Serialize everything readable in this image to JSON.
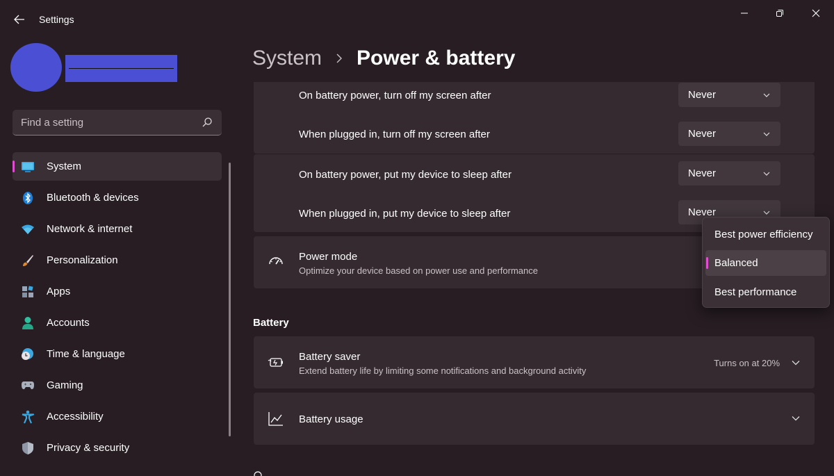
{
  "window": {
    "title": "Settings"
  },
  "search": {
    "placeholder": "Find a setting"
  },
  "nav": {
    "items": [
      {
        "label": "System",
        "icon": "monitor-icon",
        "selected": true
      },
      {
        "label": "Bluetooth & devices",
        "icon": "bluetooth-icon"
      },
      {
        "label": "Network & internet",
        "icon": "wifi-icon"
      },
      {
        "label": "Personalization",
        "icon": "brush-icon"
      },
      {
        "label": "Apps",
        "icon": "apps-icon"
      },
      {
        "label": "Accounts",
        "icon": "person-icon"
      },
      {
        "label": "Time & language",
        "icon": "globe-clock-icon"
      },
      {
        "label": "Gaming",
        "icon": "gamepad-icon"
      },
      {
        "label": "Accessibility",
        "icon": "accessibility-icon"
      },
      {
        "label": "Privacy & security",
        "icon": "shield-icon"
      }
    ]
  },
  "header": {
    "parent": "System",
    "current": "Power & battery"
  },
  "screen_sleep": {
    "rows": [
      {
        "label": "On battery power, turn off my screen after",
        "value": "Never"
      },
      {
        "label": "When plugged in, turn off my screen after",
        "value": "Never"
      },
      {
        "label": "On battery power, put my device to sleep after",
        "value": "Never"
      },
      {
        "label": "When plugged in, put my device to sleep after",
        "value": "Never"
      }
    ]
  },
  "power_mode": {
    "title": "Power mode",
    "subtitle": "Optimize your device based on power use and performance",
    "options": [
      "Best power efficiency",
      "Balanced",
      "Best performance"
    ],
    "selected": "Balanced"
  },
  "battery": {
    "section_label": "Battery",
    "saver": {
      "title": "Battery saver",
      "subtitle": "Extend battery life by limiting some notifications and background activity",
      "status": "Turns on at 20%"
    },
    "usage": {
      "title": "Battery usage"
    }
  },
  "colors": {
    "accent": "#e04fd0",
    "background": "#271d23",
    "card": "#342a30"
  }
}
